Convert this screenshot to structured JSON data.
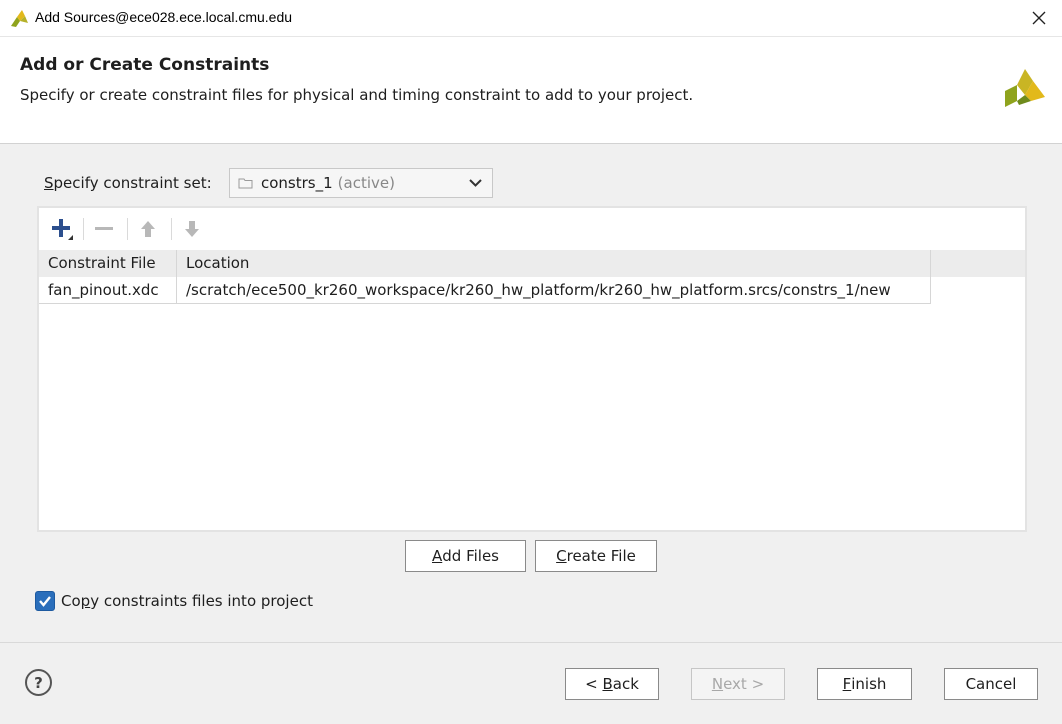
{
  "window": {
    "title": "Add Sources@ece028.ece.local.cmu.edu",
    "close_icon": "close-icon"
  },
  "header": {
    "title": "Add or Create Constraints",
    "subtitle": "Specify or create constraint files for physical and timing constraint to add to your project."
  },
  "constraint_set": {
    "label_first": "S",
    "label_rest": "pecify constraint set:",
    "value": "constrs_1",
    "suffix": "(active)"
  },
  "toolbar": {
    "icons": [
      "add-icon",
      "remove-icon",
      "move-up-icon",
      "move-down-icon"
    ]
  },
  "table": {
    "columns": [
      "Constraint File",
      "Location"
    ],
    "rows": [
      {
        "file": "fan_pinout.xdc",
        "location": "/scratch/ece500_kr260_workspace/kr260_hw_platform/kr260_hw_platform.srcs/constrs_1/new"
      }
    ]
  },
  "actions": {
    "add_files_u": "A",
    "add_files_rest": "dd Files",
    "create_file_u": "C",
    "create_file_rest": "reate File"
  },
  "copy_option": {
    "checked": true,
    "label_pre": "Co",
    "label_u": "p",
    "label_post": "y constraints files into project"
  },
  "footer": {
    "help": "?",
    "back_pre": "< ",
    "back_u": "B",
    "back_post": "ack",
    "next_u": "N",
    "next_post": "ext >",
    "finish_u": "F",
    "finish_post": "inish",
    "cancel": "Cancel"
  },
  "colors": {
    "accent": "#2a6ebb",
    "icon_blue": "#2c4f8e",
    "logo_green": "#8fa31d",
    "logo_yellow": "#e2b91b"
  }
}
